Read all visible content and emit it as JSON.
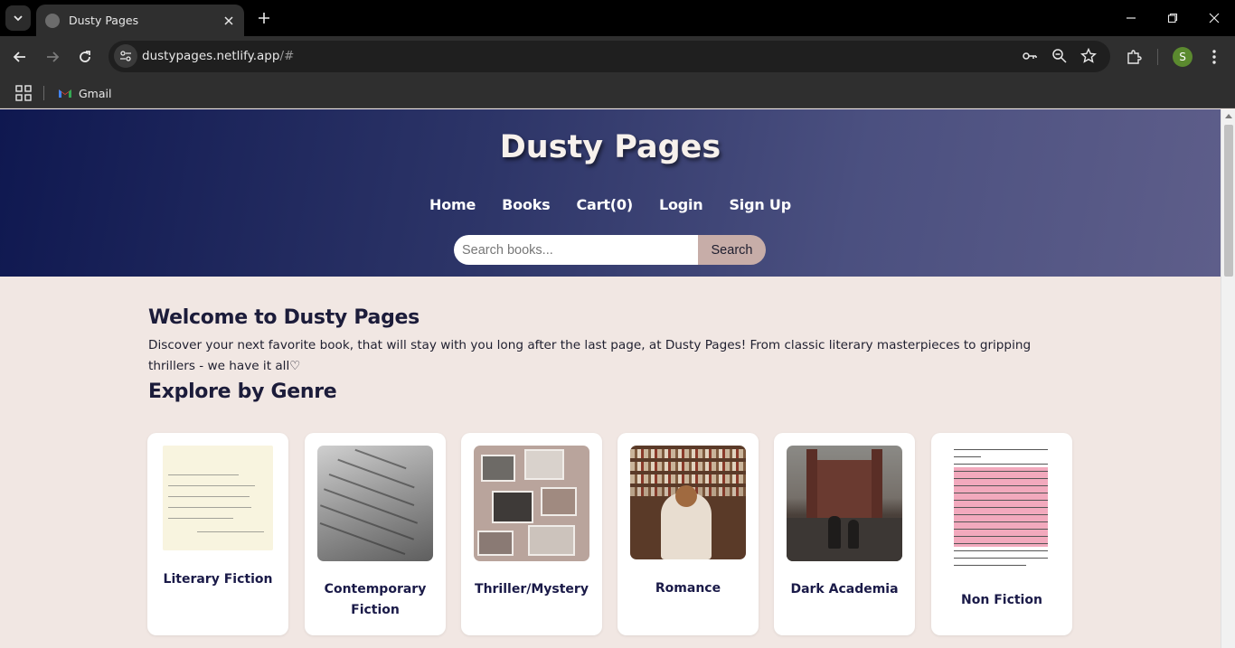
{
  "browser": {
    "tab_title": "Dusty Pages",
    "url_host": "dustypages.netlify.app",
    "url_path": "/#",
    "profile_initial": "S",
    "bookmarks": [
      {
        "label": "Gmail"
      }
    ]
  },
  "site": {
    "title": "Dusty Pages",
    "nav": [
      "Home",
      "Books",
      "Cart(0)",
      "Login",
      "Sign Up"
    ],
    "search": {
      "placeholder": "Search books...",
      "button_label": "Search"
    }
  },
  "main": {
    "welcome_heading": "Welcome to Dusty Pages",
    "intro_text": "Discover your next favorite book, that will stay with you long after the last page, at Dusty Pages! From classic literary masterpieces to gripping thrillers - we have it all♡",
    "explore_heading": "Explore by Genre",
    "genres": [
      {
        "label": "Literary Fiction"
      },
      {
        "label": "Contemporary Fiction"
      },
      {
        "label": "Thriller/Mystery"
      },
      {
        "label": "Romance"
      },
      {
        "label": "Dark Academia"
      },
      {
        "label": "Non Fiction"
      }
    ]
  }
}
